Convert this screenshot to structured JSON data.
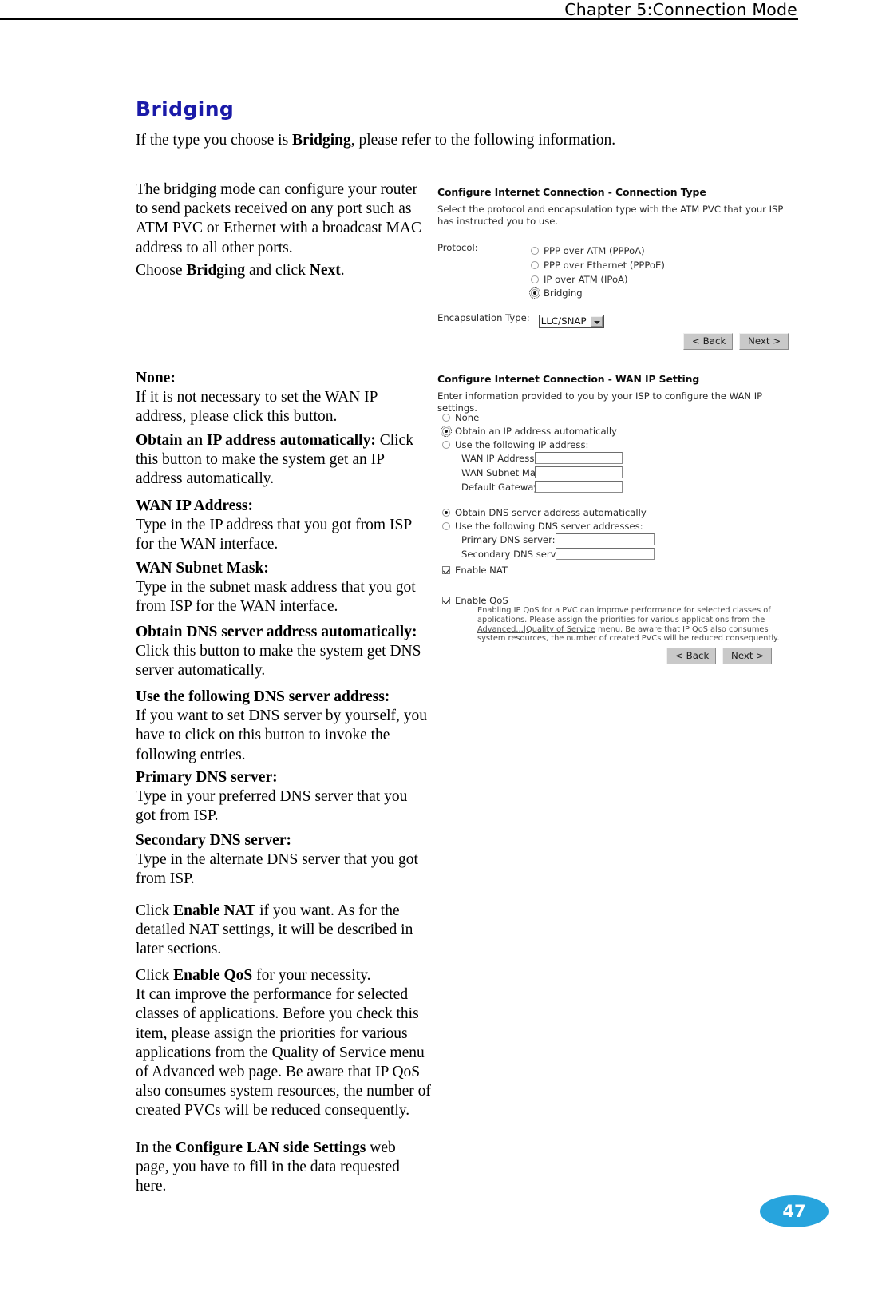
{
  "header": {
    "chapter_text": "Chapter 5:Connection Mode"
  },
  "page_number": "47",
  "section": {
    "title": "Bridging",
    "intro_prefix": "If the type you choose is ",
    "intro_bold": "Bridging",
    "intro_suffix": ", please refer to the following information.",
    "bridge_desc": "The bridging mode can configure your router to send packets received on any port such as ATM PVC or Ethernet with a broadcast MAC address to all other ports.",
    "choose_prefix": "Choose ",
    "choose_bold1": "Bridging",
    "choose_middle": " and click ",
    "choose_bold2": "Next",
    "choose_suffix": "."
  },
  "descriptions": [
    {
      "term": "None:",
      "body": "If it is not necessary to set the WAN IP address, please click this button.",
      "inline": false
    },
    {
      "term": "Obtain an IP address automatically:",
      "body": " Click this button to make the system get an IP address automatically.",
      "inline": true
    },
    {
      "term": "WAN IP Address:",
      "body": "Type in the IP address that you got from ISP for the WAN interface.",
      "inline": false
    },
    {
      "term": "WAN Subnet Mask:",
      "body": "Type in the subnet mask address that you got from ISP for the WAN interface.",
      "inline": false
    },
    {
      "term": "Obtain DNS server address automatically:",
      "body": "Click this button to make the system get DNS server automatically.",
      "inline": false
    },
    {
      "term": "Use the following DNS server address:",
      "body": "If you want to set DNS server by yourself, you have to click on this button to invoke the following entries.",
      "inline": false
    },
    {
      "term": "Primary DNS server:",
      "body": "Type in your preferred DNS server that you got from ISP.",
      "inline": false
    },
    {
      "term": "Secondary DNS server:",
      "body": "Type in the alternate DNS server that you got from ISP.",
      "inline": false
    }
  ],
  "nat_para": {
    "prefix": "Click ",
    "bold": "Enable NAT",
    "suffix": " if you want. As for the detailed NAT settings, it will be described in later sections."
  },
  "qos_para": {
    "prefix": "Click ",
    "bold": "Enable QoS",
    "suffix": " for your necessity.",
    "body": "It can improve the performance for selected classes of applications. Before you check this item, please assign the priorities for various applications from the Quality of Service menu of Advanced web page. Be aware that IP QoS also consumes system resources, the number of created PVCs will be reduced consequently."
  },
  "lan_para": {
    "prefix": "In the ",
    "bold": "Configure LAN side Settings",
    "suffix": " web page, you have to fill in the data requested here."
  },
  "screenshot_connection_type": {
    "title": "Configure Internet Connection - Connection Type",
    "description": "Select the protocol and encapsulation type with the ATM PVC that your ISP has instructed you to use.",
    "protocol_label": "Protocol:",
    "options": [
      {
        "label": "PPP over ATM (PPPoA)",
        "selected": false
      },
      {
        "label": "PPP over Ethernet (PPPoE)",
        "selected": false
      },
      {
        "label": "IP over ATM (IPoA)",
        "selected": false
      },
      {
        "label": "Bridging",
        "selected": true
      }
    ],
    "encapsulation_label": "Encapsulation Type:",
    "encapsulation_value": "LLC/SNAP",
    "back_button": "< Back",
    "next_button": "Next >"
  },
  "screenshot_wan_ip": {
    "title": "Configure Internet Connection - WAN IP Setting",
    "description": "Enter information provided to you by your ISP to configure the WAN IP settings.",
    "ip_options": [
      {
        "label": "None",
        "selected": false
      },
      {
        "label": "Obtain an IP address automatically",
        "selected": true
      },
      {
        "label": "Use the following IP address:",
        "selected": false
      }
    ],
    "ip_fields": [
      {
        "label": "WAN IP Address:",
        "value": ""
      },
      {
        "label": "WAN Subnet Mask:",
        "value": ""
      },
      {
        "label": "Default Gateway:",
        "value": ""
      }
    ],
    "dns_options": [
      {
        "label": "Obtain DNS server address automatically",
        "selected": true
      },
      {
        "label": "Use the following DNS server addresses:",
        "selected": false
      }
    ],
    "dns_fields": [
      {
        "label": "Primary DNS server:",
        "value": ""
      },
      {
        "label": "Secondary DNS server:",
        "value": ""
      }
    ],
    "enable_nat": {
      "label": "Enable NAT",
      "checked": true
    },
    "enable_qos": {
      "label": "Enable QoS",
      "checked": true
    },
    "qos_note_part1": "Enabling IP QoS for a PVC can improve performance for selected classes of applications. Please assign the priorities for various applications from the ",
    "qos_note_link": "Advanced...|Quality of Service",
    "qos_note_part2": " menu. Be aware that IP QoS also consumes system resources, the number of created PVCs will be reduced consequently.",
    "back_button": "< Back",
    "next_button": "Next >"
  },
  "colors": {
    "heading": "#1a1aa8",
    "page_badge": "#27a4dd"
  }
}
